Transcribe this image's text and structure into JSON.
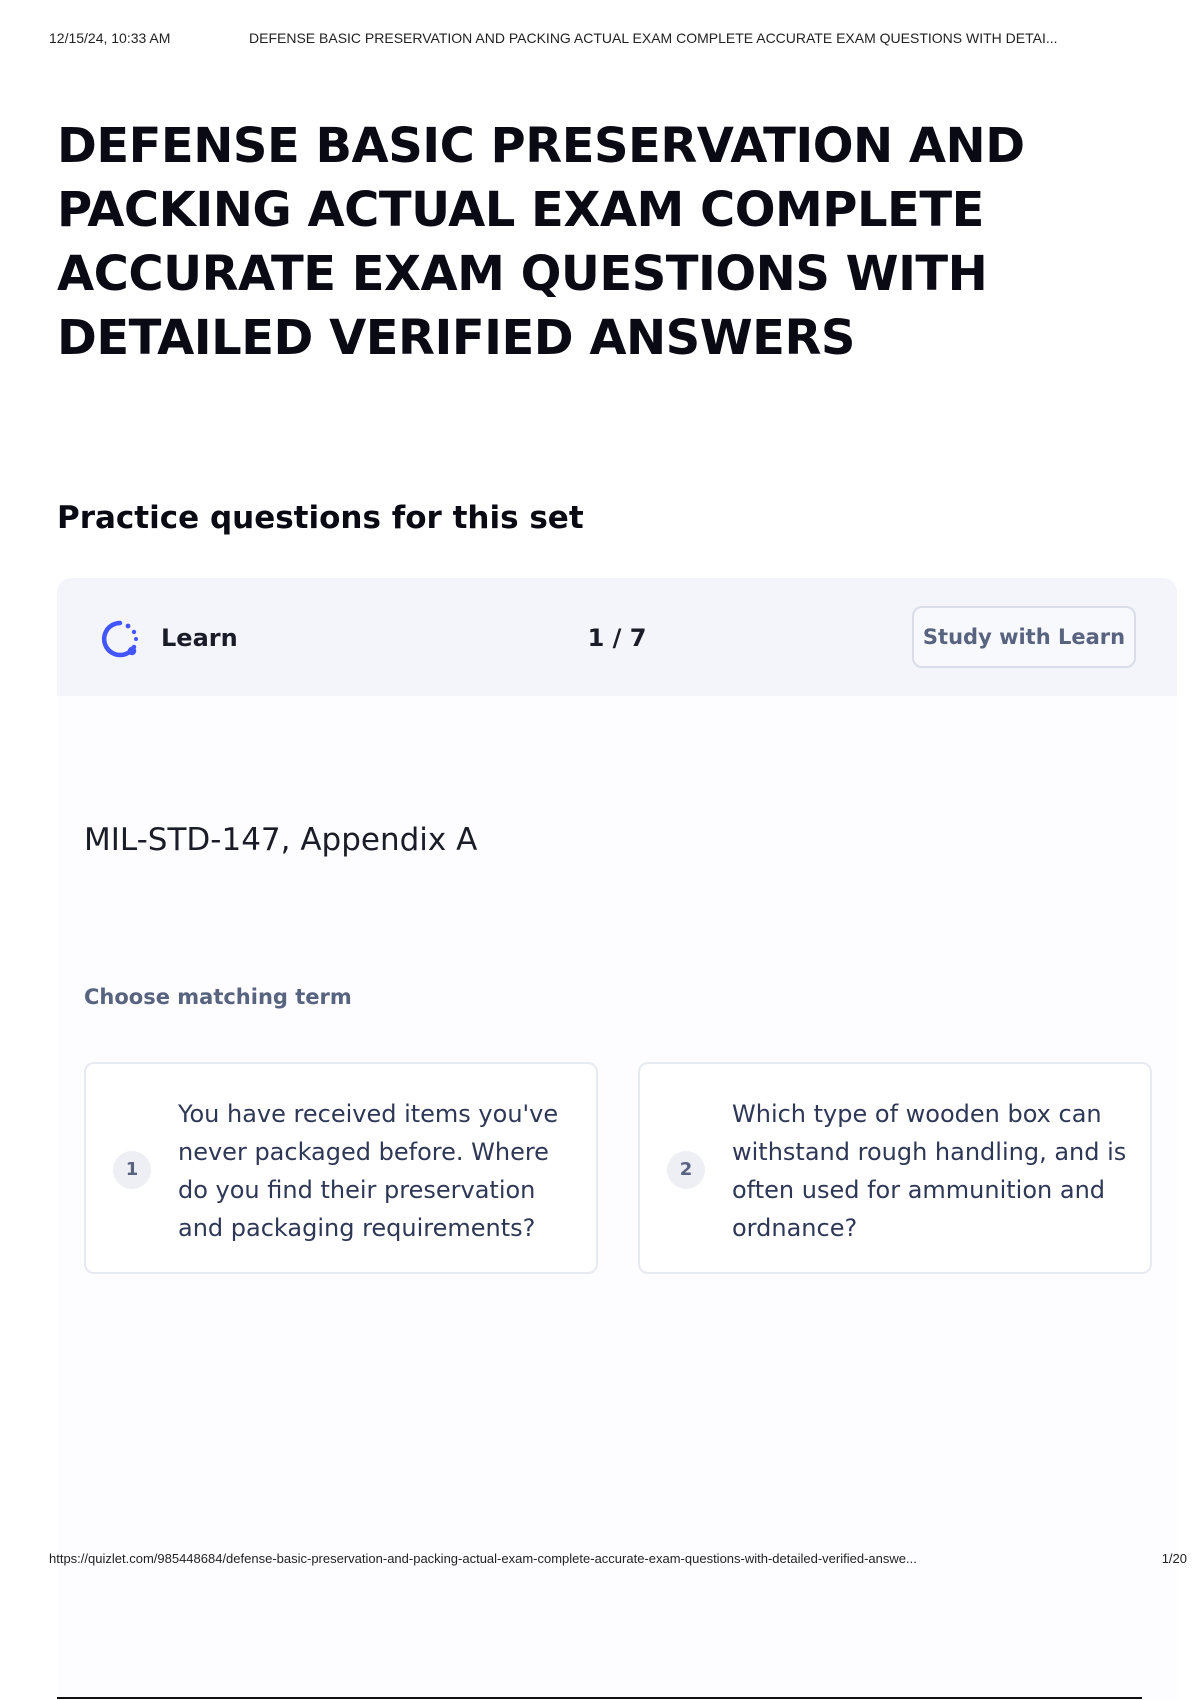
{
  "print_header": {
    "datetime": "12/15/24, 10:33 AM",
    "title": "DEFENSE BASIC PRESERVATION AND PACKING ACTUAL EXAM COMPLETE ACCURATE EXAM QUESTIONS WITH DETAI..."
  },
  "page": {
    "title": "DEFENSE BASIC PRESERVATION AND PACKING ACTUAL EXAM COMPLETE ACCURATE EXAM QUESTIONS WITH DETAILED VERIFIED ANSWERS",
    "section_heading": "Practice questions for this set"
  },
  "practice": {
    "mode_label": "Learn",
    "mode_icon": "learn-progress-icon",
    "counter": "1 / 7",
    "study_button_label": "Study with Learn",
    "term": "MIL-STD-147, Appendix A",
    "prompt": "Choose matching term",
    "options": [
      {
        "number": "1",
        "text": "You have received items you've never packaged before. Where do you find their preservation and packaging requirements?"
      },
      {
        "number": "2",
        "text": "Which type of wooden box can withstand rough handling, and is often used for ammunition and ordnance?"
      }
    ]
  },
  "print_footer": {
    "url": "https://quizlet.com/985448684/defense-basic-preservation-and-packing-actual-exam-complete-accurate-exam-questions-with-detailed-verified-answe...",
    "page": "1/20"
  },
  "colors": {
    "accent": "#4255ff",
    "card_header_bg": "#f4f5fa",
    "muted_text": "#586380",
    "border": "#e8eaf1"
  }
}
